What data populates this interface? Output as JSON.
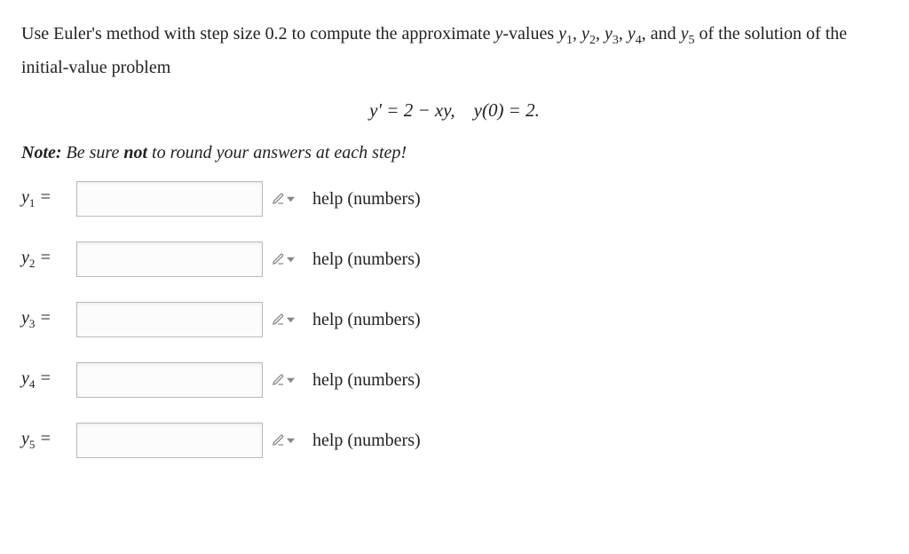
{
  "problem": {
    "text_part1": "Use Euler's method with step size ",
    "step_size": "0.2",
    "text_part2": " to compute the approximate ",
    "yvar": "y",
    "text_part3": "-values ",
    "y1": "y",
    "s1": "1",
    "y2": "y",
    "s2": "2",
    "y3": "y",
    "s3": "3",
    "y4": "y",
    "s4": "4",
    "text_part4": ", and ",
    "y5": "y",
    "s5": "5",
    "text_part5": " of the solution of the initial-value problem"
  },
  "equation": {
    "lhs": "y′ = 2 − xy,",
    "rhs": "y(0) = 2."
  },
  "note": {
    "label": "Note:",
    "before": " Be sure ",
    "bold": "not",
    "after": " to round your answers at each step!"
  },
  "rows": [
    {
      "var": "y",
      "sub": "1",
      "eq": " =",
      "help": "help (numbers)"
    },
    {
      "var": "y",
      "sub": "2",
      "eq": " =",
      "help": "help (numbers)"
    },
    {
      "var": "y",
      "sub": "3",
      "eq": " =",
      "help": "help (numbers)"
    },
    {
      "var": "y",
      "sub": "4",
      "eq": " =",
      "help": "help (numbers)"
    },
    {
      "var": "y",
      "sub": "5",
      "eq": " =",
      "help": "help (numbers)"
    }
  ]
}
